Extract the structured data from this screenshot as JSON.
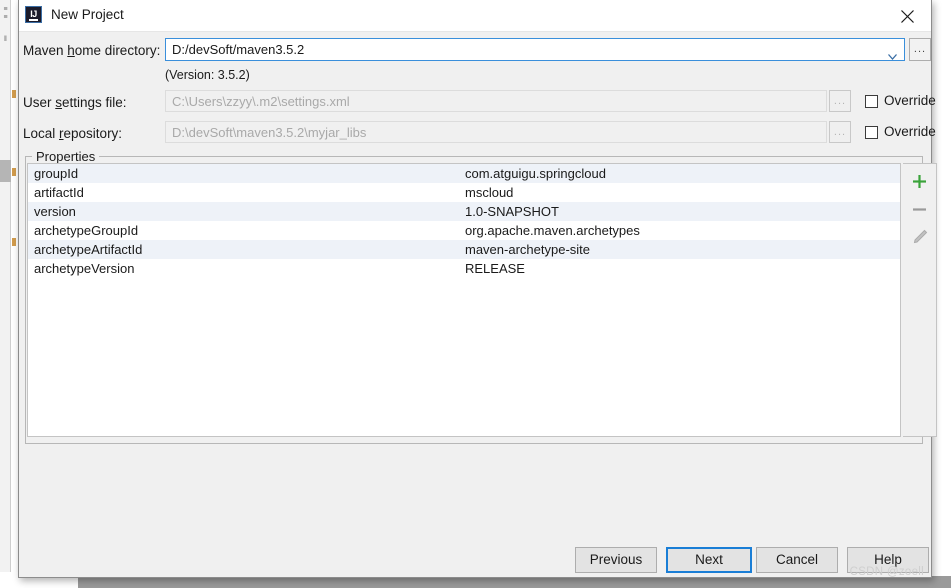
{
  "window": {
    "title": "New Project",
    "app_icon": "intellij-idea-icon",
    "close_icon": "close-icon"
  },
  "form": {
    "maven_home": {
      "label_before": "Maven ",
      "label_mnemonic": "h",
      "label_after": "ome directory:",
      "value": "D:/devSoft/maven3.5.2",
      "browse_label": "...",
      "dropdown_icon": "chevron-down-icon"
    },
    "version_note": "(Version: 3.5.2)",
    "user_settings": {
      "label_before": "User ",
      "label_mnemonic": "s",
      "label_after": "ettings file:",
      "value": "C:\\Users\\zzyy\\.m2\\settings.xml",
      "browse_label": "...",
      "override_label": "Override",
      "override_checked": false
    },
    "local_repository": {
      "label_before": "Local ",
      "label_mnemonic": "r",
      "label_after": "epository:",
      "value": "D:\\devSoft\\maven3.5.2\\myjar_libs",
      "browse_label": "...",
      "override_label": "Override",
      "override_checked": false
    }
  },
  "properties": {
    "group_title": "Properties",
    "rows": [
      {
        "key": "groupId",
        "value": "com.atguigu.springcloud"
      },
      {
        "key": "artifactId",
        "value": "mscloud"
      },
      {
        "key": "version",
        "value": "1.0-SNAPSHOT"
      },
      {
        "key": "archetypeGroupId",
        "value": "org.apache.maven.archetypes"
      },
      {
        "key": "archetypeArtifactId",
        "value": "maven-archetype-site"
      },
      {
        "key": "archetypeVersion",
        "value": "RELEASE"
      }
    ],
    "toolbar": {
      "add_icon": "plus-icon",
      "remove_icon": "minus-icon",
      "edit_icon": "pencil-icon",
      "add_color": "#3aa33a",
      "remove_color": "#9a9a9a",
      "edit_color": "#b4b4b4"
    }
  },
  "footer": {
    "previous_label": "Previous",
    "next_label": "Next",
    "cancel_label": "Cancel",
    "help_label": "Help",
    "focused_button": "Next",
    "focus_color": "#1a7ed6"
  },
  "watermark": "CSDN @zoell",
  "ide_background": {
    "glyphs": [
      "≡",
      "≡",
      "‖"
    ]
  }
}
